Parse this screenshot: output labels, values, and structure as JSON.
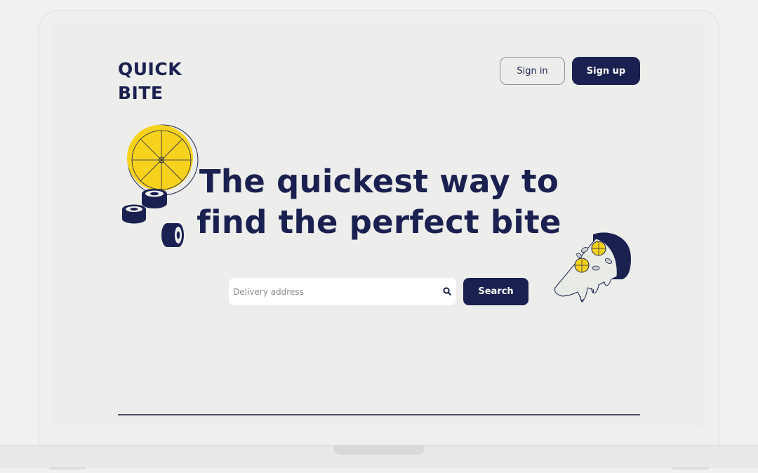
{
  "brand": {
    "line1": "QUICK",
    "line2": "BITE"
  },
  "header": {
    "signin_label": "Sign in",
    "signup_label": "Sign up"
  },
  "hero": {
    "line1": "The quickest way to",
    "line2": "find the perfect bite"
  },
  "search": {
    "placeholder": "Delivery address",
    "button_label": "Search",
    "icon": "search-icon"
  },
  "colors": {
    "primary": "#1a2150",
    "accent_yellow": "#f7d21c",
    "background": "#edeeeb"
  },
  "icons": {
    "left_illustration": "lemon-and-sushi-illustration",
    "right_illustration": "pizza-slice-illustration"
  }
}
